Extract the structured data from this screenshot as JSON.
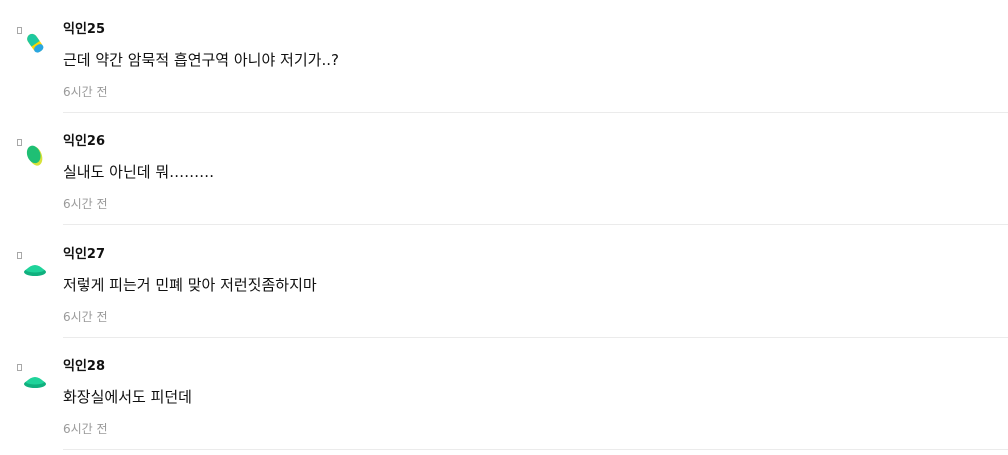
{
  "comments": [
    {
      "author": "익인25",
      "text": "근데 약간 암묵적 흡연구역 아니야 저기가..?",
      "time": "6시간 전",
      "avatar_icon": "tilted-capsule-icon",
      "avatar_colors": [
        "#1ec8a0",
        "#ffd600",
        "#2aa6e0"
      ]
    },
    {
      "author": "익인26",
      "text": "실내도 아닌데 뭐………",
      "time": "6시간 전",
      "avatar_icon": "leaf-blob-icon",
      "avatar_colors": [
        "#1fbf74",
        "#d7e23a"
      ]
    },
    {
      "author": "익인27",
      "text": "저렇게 피는거 민폐 맞아 저런짓좀하지마",
      "time": "6시간 전",
      "avatar_icon": "mushroom-cap-icon",
      "avatar_colors": [
        "#1fd39a",
        "#10b07e"
      ]
    },
    {
      "author": "익인28",
      "text": "화장실에서도 피던데",
      "time": "6시간 전",
      "avatar_icon": "mushroom-cap-icon",
      "avatar_colors": [
        "#1fd39a",
        "#10b07e"
      ]
    }
  ]
}
